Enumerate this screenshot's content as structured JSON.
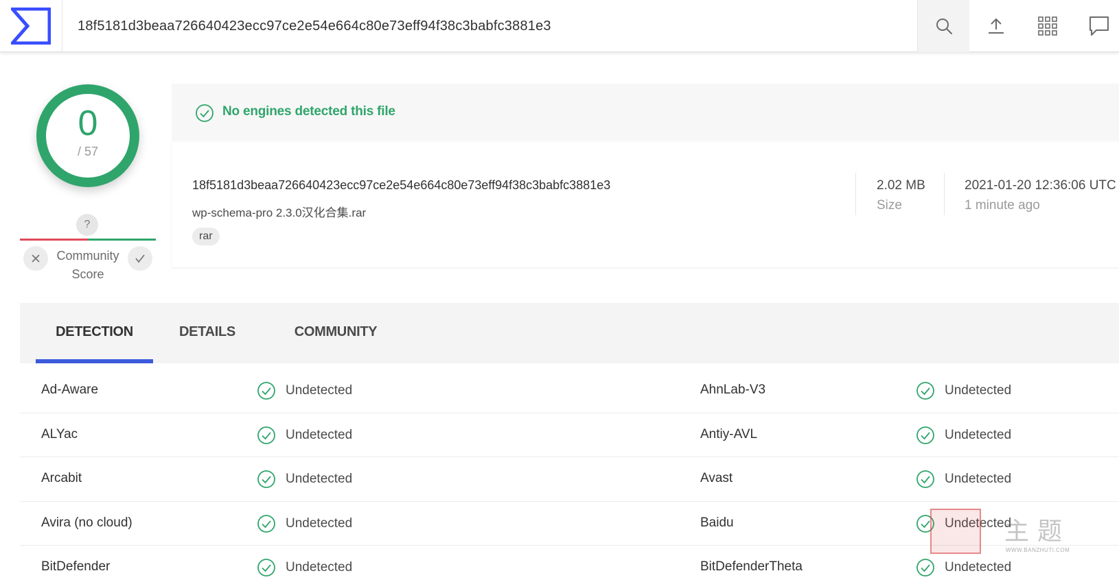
{
  "search": {
    "value": "18f5181d3beaa726640423ecc97ce2e54e664c80e73eff94f38c3babfc3881e3"
  },
  "score": {
    "detections": "0",
    "total": "/ 57",
    "ring_color": "#2fa56b"
  },
  "community": {
    "question": "?",
    "label": "Community Score"
  },
  "banner": {
    "text": "No engines detected this file",
    "color": "#2fa56b"
  },
  "file": {
    "hash": "18f5181d3beaa726640423ecc97ce2e54e664c80e73eff94f38c3babfc3881e3",
    "name": "wp-schema-pro 2.3.0汉化合集.rar",
    "tag": "rar",
    "size_value": "2.02 MB",
    "size_label": "Size",
    "date_value": "2021-01-20 12:36:06 UTC",
    "date_relative": "1 minute ago"
  },
  "tabs": [
    {
      "label": "DETECTION"
    },
    {
      "label": "DETAILS"
    },
    {
      "label": "COMMUNITY"
    }
  ],
  "accent_color": "#3b5bdb",
  "results": [
    {
      "left_engine": "Ad-Aware",
      "left_status": "Undetected",
      "right_engine": "AhnLab-V3",
      "right_status": "Undetected"
    },
    {
      "left_engine": "ALYac",
      "left_status": "Undetected",
      "right_engine": "Antiy-AVL",
      "right_status": "Undetected"
    },
    {
      "left_engine": "Arcabit",
      "left_status": "Undetected",
      "right_engine": "Avast",
      "right_status": "Undetected"
    },
    {
      "left_engine": "Avira (no cloud)",
      "left_status": "Undetected",
      "right_engine": "Baidu",
      "right_status": "Undetected"
    },
    {
      "left_engine": "BitDefender",
      "left_status": "Undetected",
      "right_engine": "BitDefenderTheta",
      "right_status": "Undetected"
    }
  ],
  "watermark": {
    "chars": "主题",
    "url": "WWW.BANZHUTI.COM"
  }
}
